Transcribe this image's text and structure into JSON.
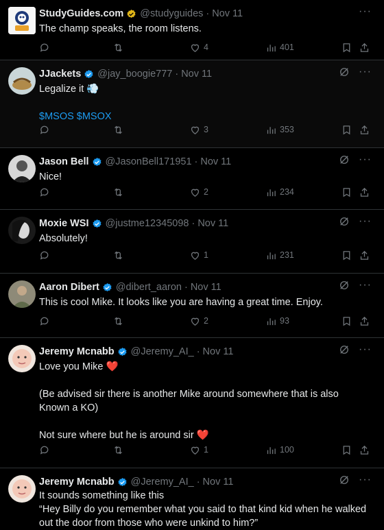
{
  "tweets": [
    {
      "name": "StudyGuides.com",
      "handle": "@studyguides",
      "date": "Nov 11",
      "badge_color": "#e2b719",
      "text": [
        "The champ speaks, the room listens."
      ],
      "replies": "",
      "retweets": "",
      "likes": "4",
      "views": "401",
      "show_grok": false
    },
    {
      "name": "JJackets",
      "handle": "@jay_boogie777",
      "date": "Nov 11",
      "badge_color": "#1d9bf0",
      "text": [
        "Legalize it 💨",
        "",
        "$MSOS $MSOX"
      ],
      "replies": "",
      "retweets": "",
      "likes": "3",
      "views": "353",
      "show_grok": true
    },
    {
      "name": "Jason Bell",
      "handle": "@JasonBell171951",
      "date": "Nov 11",
      "badge_color": "#1d9bf0",
      "text": [
        "Nice!"
      ],
      "replies": "",
      "retweets": "",
      "likes": "2",
      "views": "234",
      "show_grok": true
    },
    {
      "name": "Moxie WSI",
      "handle": "@justme12345098",
      "date": "Nov 11",
      "badge_color": "#1d9bf0",
      "text": [
        "Absolutely!"
      ],
      "replies": "",
      "retweets": "",
      "likes": "1",
      "views": "231",
      "show_grok": true
    },
    {
      "name": "Aaron Dibert",
      "handle": "@dibert_aaron",
      "date": "Nov 11",
      "badge_color": "#1d9bf0",
      "text": [
        "This is cool Mike. It looks like you are having a great time. Enjoy."
      ],
      "replies": "",
      "retweets": "",
      "likes": "2",
      "views": "93",
      "show_grok": true
    },
    {
      "name": "Jeremy Mcnabb",
      "handle": "@Jeremy_AI_",
      "date": "Nov 11",
      "badge_color": "#1d9bf0",
      "text": [
        "Love you Mike ❤️",
        "",
        "(Be advised sir there is another Mike around somewhere that is also Known a KO)",
        "",
        "Not sure where but he is around sir ❤️"
      ],
      "replies": "",
      "retweets": "",
      "likes": "1",
      "views": "100",
      "show_grok": true
    },
    {
      "name": "Jeremy Mcnabb",
      "handle": "@Jeremy_AI_",
      "date": "Nov 11",
      "badge_color": "#1d9bf0",
      "text": [
        "It sounds something like this",
        "“Hey Billy do you remember what you said to that kind kid when he walked out the door from those who were unkind to him?”"
      ],
      "show_grok": true
    }
  ],
  "separator": "·",
  "more_label": "···"
}
